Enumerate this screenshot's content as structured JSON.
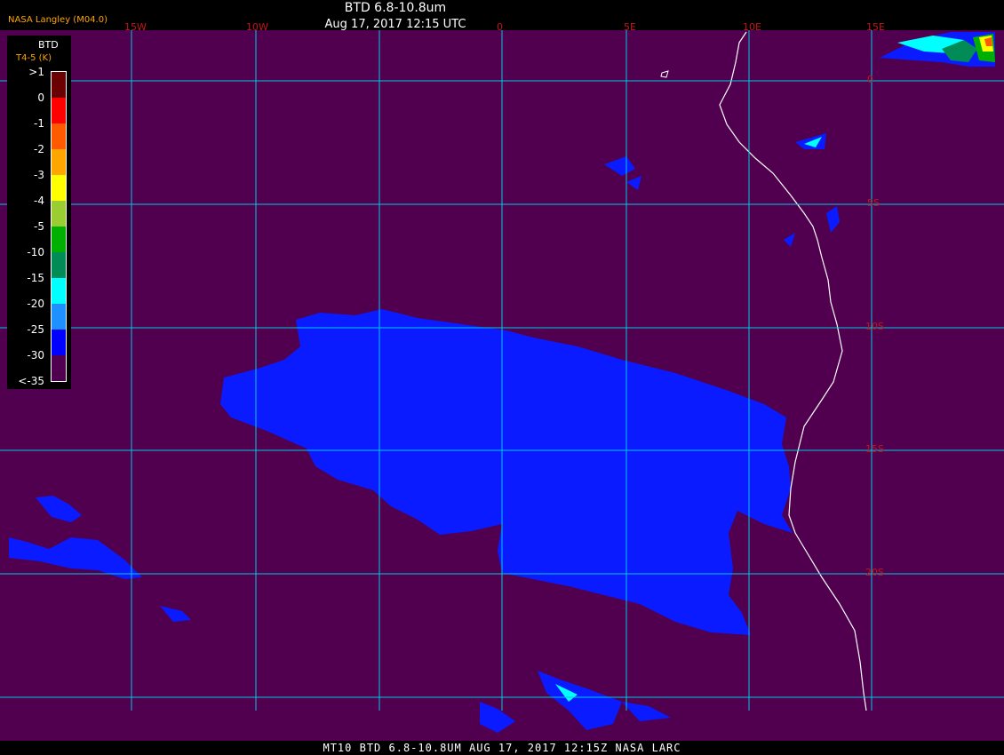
{
  "header": {
    "title": "BTD 6.8-10.8um",
    "subtitle": "Aug 17, 2017 12:15 UTC",
    "credit": "NASA Langley (M04.0)"
  },
  "grid_labels": {
    "lon": [
      "15W",
      "10W",
      "0",
      "5E",
      "10E",
      "15E"
    ],
    "lat": [
      "0",
      "5S",
      "10S",
      "15S",
      "20S"
    ]
  },
  "legend": {
    "title": "BTD",
    "subtitle": "T4-5 (K)",
    "labels": [
      ">1",
      "0",
      "-1",
      "-2",
      "-3",
      "-4",
      "-5",
      "-10",
      "-15",
      "-20",
      "-25",
      "-30",
      "<-35"
    ],
    "colors": [
      "#6b0000",
      "#ff0000",
      "#ff5a00",
      "#ffa500",
      "#ffff00",
      "#9acd32",
      "#00b000",
      "#008b57",
      "#00ffff",
      "#1e90ff",
      "#0000ff",
      "#50004f"
    ]
  },
  "colors": {
    "background": "#50004f",
    "grid": "#00c8e0",
    "coast": "#ffffff",
    "cloud": "#0a1cff"
  },
  "footer": {
    "text": "MT10  BTD 6.8-10.8UM   AUG 17, 2017 12:15Z   NASA LARC"
  }
}
